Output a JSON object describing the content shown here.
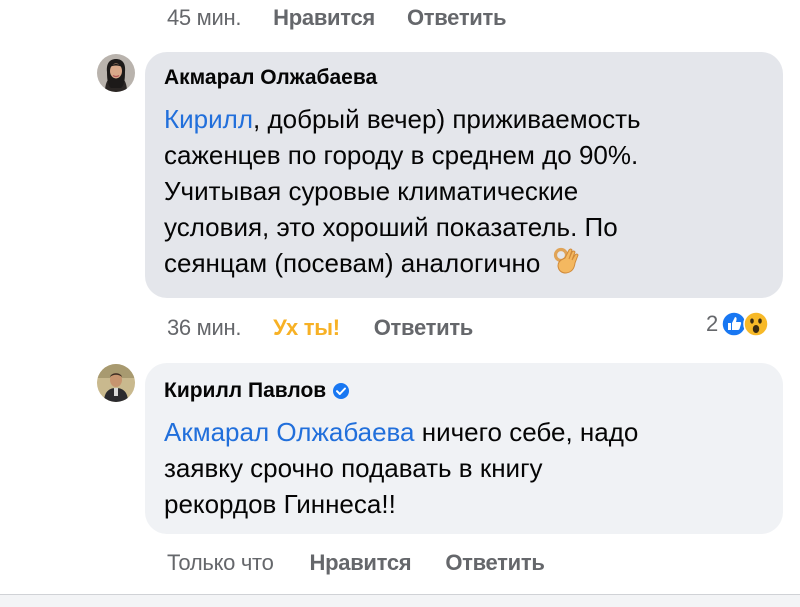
{
  "top_actions": {
    "timestamp": "45 мин.",
    "like": "Нравится",
    "reply": "Ответить"
  },
  "comment1": {
    "author": "Акмарал Олжабаева",
    "mention": "Кирилл",
    "text_line1_rest": ", добрый вечер) приживаемость",
    "text_line2": "саженцев по городу в среднем до 90%.",
    "text_line3": "Учитывая суровые климатические",
    "text_line4": "условия, это хороший показатель. По",
    "text_line5": "сеянцам (посевам) аналогично",
    "emoji_icon": "ok-hand-emoji",
    "actions": {
      "timestamp": "36 мин.",
      "reaction": "Ух ты!",
      "reply": "Ответить"
    },
    "reactions": {
      "count": "2",
      "icons": [
        "like-reaction-icon",
        "wow-reaction-icon"
      ]
    }
  },
  "comment2": {
    "author": "Кирилл Павлов",
    "verified": true,
    "mention": "Акмарал Олжабаева",
    "text_line1_rest": " ничего себе, надо",
    "text_line2": "заявку срочно подавать в книгу",
    "text_line3": "рекордов Гиннеса!!",
    "actions": {
      "timestamp": "Только что",
      "like": "Нравится",
      "reply": "Ответить"
    }
  },
  "colors": {
    "mention": "#216fdb",
    "muted": "#65676b",
    "wow": "#f7b125",
    "bubble_gray": "#e4e6eb",
    "bubble_light": "#f0f2f5"
  }
}
